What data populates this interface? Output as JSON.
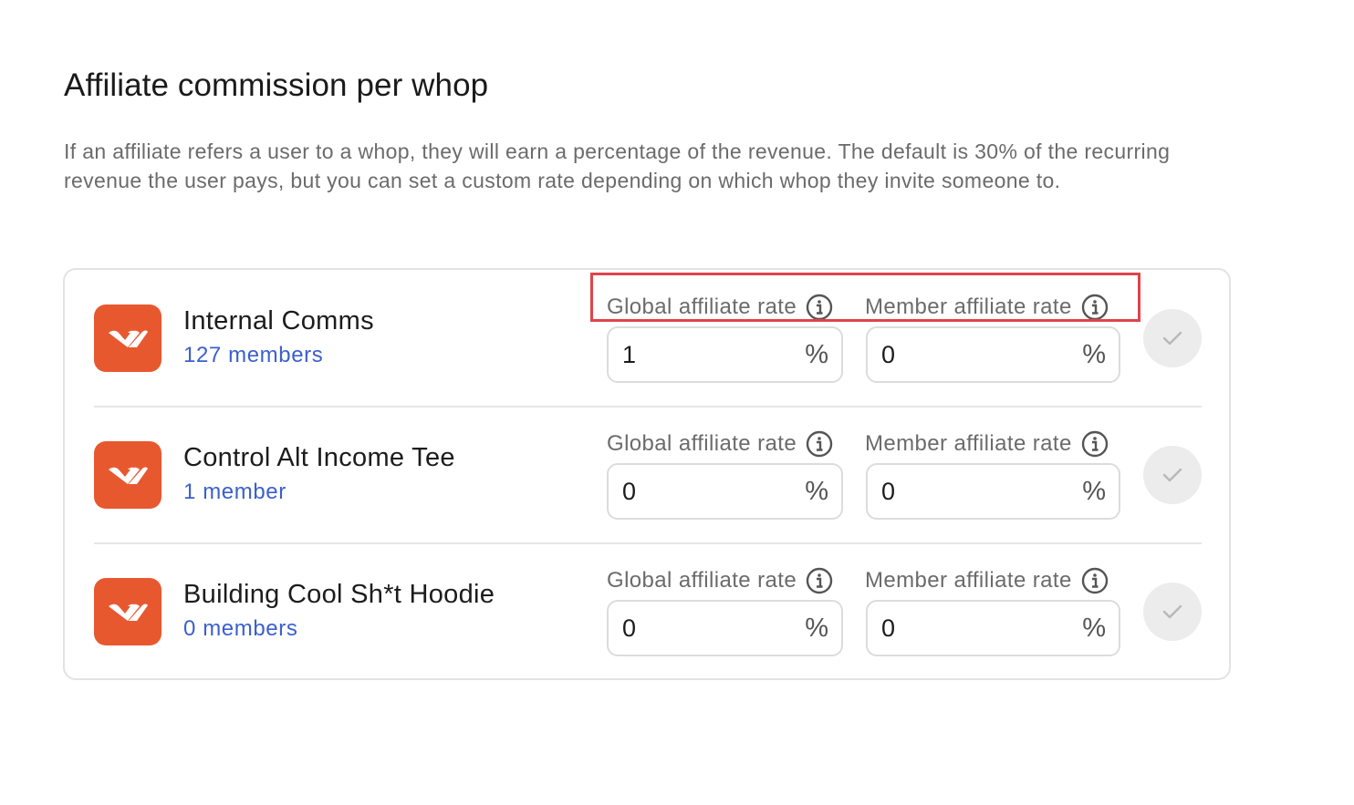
{
  "section": {
    "title": "Affiliate commission per whop",
    "description": "If an affiliate refers a user to a whop, they will earn a percentage of the revenue. The default is 30% of the recurring revenue the user pays, but you can set a custom rate depending on which whop they invite someone to."
  },
  "labels": {
    "global_rate": "Global affiliate rate",
    "member_rate": "Member affiliate rate",
    "percent": "%"
  },
  "whops": [
    {
      "name": "Internal Comms",
      "members": "127 members",
      "global_rate": "1",
      "member_rate": "0"
    },
    {
      "name": "Control Alt Income Tee",
      "members": "1 member",
      "global_rate": "0",
      "member_rate": "0"
    },
    {
      "name": "Building Cool Sh*t Hoodie",
      "members": "0 members",
      "global_rate": "0",
      "member_rate": "0"
    }
  ],
  "colors": {
    "brand": "#e8582f",
    "link": "#3b5fce",
    "highlight": "#e0434c"
  },
  "icons": {
    "logo": "whop-logo-icon",
    "info": "info-icon",
    "save": "checkmark-icon"
  }
}
